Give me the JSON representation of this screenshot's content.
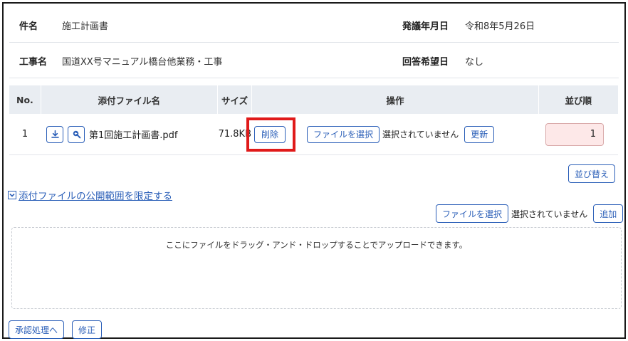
{
  "info": {
    "subject_label": "件名",
    "subject_value": "施工計画書",
    "issue_date_label": "発議年月日",
    "issue_date_value": "令和8年5月26日",
    "project_label": "工事名",
    "project_value": "国道XX号マニュアル橋台他業務・工事",
    "reply_label": "回答希望日",
    "reply_value": "なし"
  },
  "table": {
    "headers": {
      "no": "No.",
      "file": "添付ファイル名",
      "size": "サイズ",
      "ops": "操作",
      "order": "並び順"
    },
    "rows": [
      {
        "no": "1",
        "file": "第1回施工計画書.pdf",
        "size": "71.8KB",
        "delete": "削除",
        "choose": "ファイルを選択",
        "status": "選択されていません",
        "update": "更新",
        "order": "1"
      }
    ]
  },
  "sort_button": "並び替え",
  "scope_link": "添付ファイルの公開範囲を限定する",
  "upload": {
    "choose": "ファイルを選択",
    "status": "選択されていません",
    "add": "追加"
  },
  "dropzone_text": "ここにファイルをドラッグ・アンド・ドロップすることでアップロードできます。",
  "footer": {
    "approve": "承認処理へ",
    "edit": "修正"
  }
}
